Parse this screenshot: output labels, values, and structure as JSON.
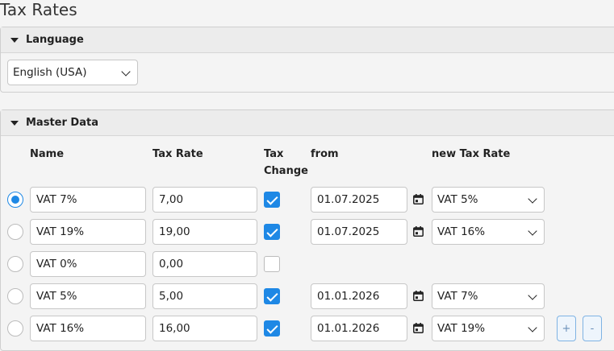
{
  "page": {
    "title": "Tax Rates"
  },
  "language_panel": {
    "header": "Language",
    "selected": "English (USA)"
  },
  "master_panel": {
    "header": "Master Data",
    "columns": {
      "name": "Name",
      "tax_rate": "Tax Rate",
      "tax_change_1": "Tax",
      "tax_change_2": "Change",
      "from": "from",
      "new_tax_rate": "new Tax Rate"
    },
    "rows": [
      {
        "name": "VAT 7%",
        "rate": "7,00",
        "change": true,
        "from": "01.07.2025",
        "new_rate": "VAT 5%",
        "selected": true
      },
      {
        "name": "VAT 19%",
        "rate": "19,00",
        "change": true,
        "from": "01.07.2025",
        "new_rate": "VAT 16%",
        "selected": false
      },
      {
        "name": "VAT 0%",
        "rate": "0,00",
        "change": false,
        "from": "",
        "new_rate": "",
        "selected": false
      },
      {
        "name": "VAT 5%",
        "rate": "5,00",
        "change": true,
        "from": "01.01.2026",
        "new_rate": "VAT 7%",
        "selected": false
      },
      {
        "name": "VAT 16%",
        "rate": "16,00",
        "change": true,
        "from": "01.01.2026",
        "new_rate": "VAT 19%",
        "selected": false
      }
    ],
    "add_button": "+",
    "remove_button": "-"
  },
  "colors": {
    "accent": "#1e88e5"
  }
}
